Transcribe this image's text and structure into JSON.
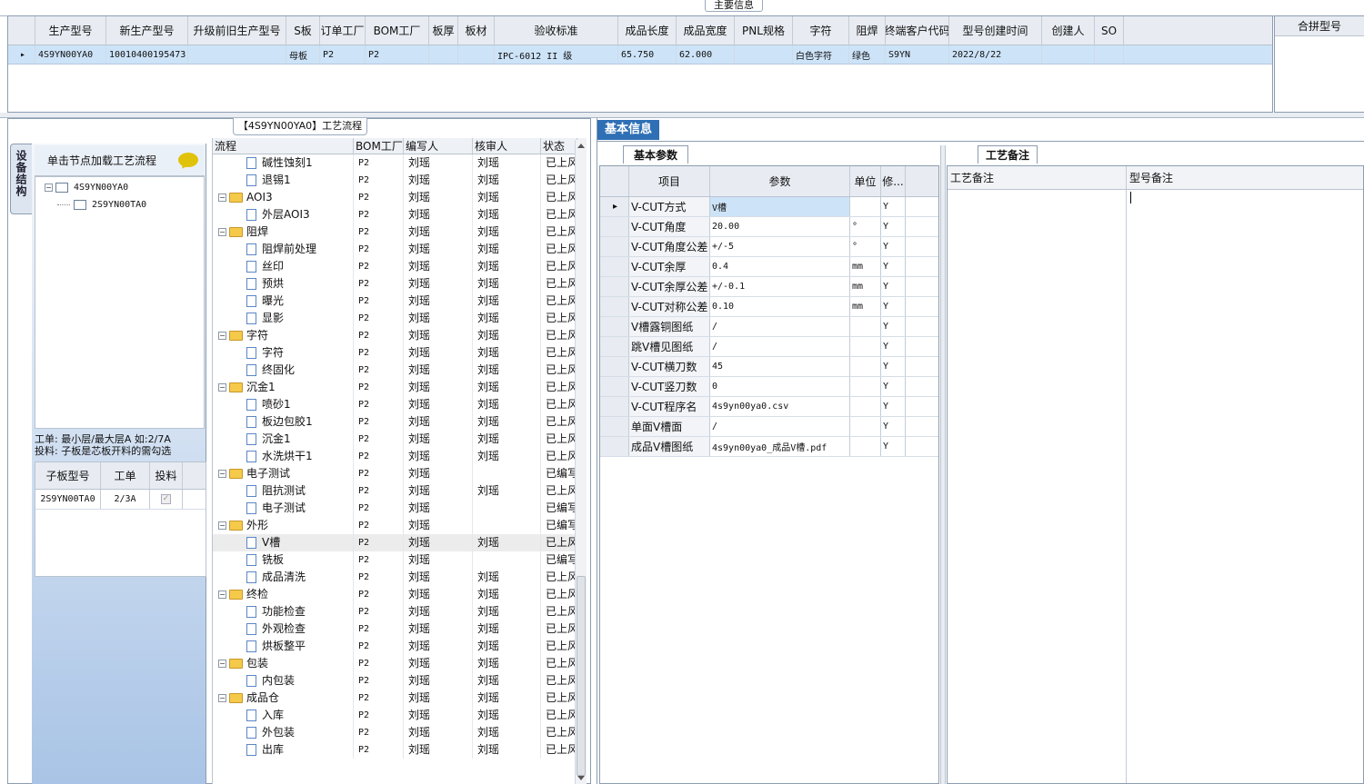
{
  "main": {
    "title": "主要信息",
    "columns": [
      "生产型号",
      "新生产型号",
      "升级前旧生产型号",
      "S板",
      "订单工厂",
      "BOM工厂",
      "板厚",
      "板材",
      "验收标准",
      "成品长度",
      "成品宽度",
      "PNL规格",
      "字符",
      "阻焊",
      "终端客户代码",
      "型号创建时间",
      "创建人",
      "SO"
    ],
    "row": [
      "4S9YN00YA0",
      "10010400195473",
      "",
      "母板",
      "P2",
      "P2",
      "",
      "",
      "IPC-6012 II 级",
      "65.750",
      "62.000",
      "",
      "白色字符",
      "绿色",
      "S9YN",
      "2022/8/22",
      "",
      ""
    ],
    "merge_title": "合拼型号"
  },
  "left": {
    "process_title": "【4S9YN00YA0】工艺流程",
    "side_tab": "设备结构",
    "click_hint": "单击节点加载工艺流程",
    "tree": [
      "4S9YN00YA0",
      "2S9YN00TA0"
    ],
    "note_line1": "工单: 最小层/最大层A 如:2/7A",
    "note_line2": "投料: 子板是芯板开料的需勾选",
    "sub_columns": [
      "子板型号",
      "工单",
      "投料"
    ],
    "sub_row": [
      "2S9YN00TA0",
      "2/3A",
      ""
    ]
  },
  "process": {
    "columns": [
      "流程",
      "BOM工厂",
      "编写人",
      "核审人",
      "状态"
    ],
    "rows": [
      {
        "name": "碱性蚀刻1",
        "level": 2,
        "type": "doc",
        "bom": "P2",
        "writer": "刘瑶",
        "reviewer": "刘瑶",
        "status": "已上风"
      },
      {
        "name": "退锡1",
        "level": 2,
        "type": "doc",
        "bom": "P2",
        "writer": "刘瑶",
        "reviewer": "刘瑶",
        "status": "已上风"
      },
      {
        "name": "AOI3",
        "level": 1,
        "type": "folder",
        "bom": "P2",
        "writer": "刘瑶",
        "reviewer": "刘瑶",
        "status": "已上风"
      },
      {
        "name": "外层AOI3",
        "level": 2,
        "type": "doc",
        "bom": "P2",
        "writer": "刘瑶",
        "reviewer": "刘瑶",
        "status": "已上风"
      },
      {
        "name": "阻焊",
        "level": 1,
        "type": "folder",
        "bom": "P2",
        "writer": "刘瑶",
        "reviewer": "刘瑶",
        "status": "已上风"
      },
      {
        "name": "阻焊前处理",
        "level": 2,
        "type": "doc",
        "bom": "P2",
        "writer": "刘瑶",
        "reviewer": "刘瑶",
        "status": "已上风"
      },
      {
        "name": "丝印",
        "level": 2,
        "type": "doc",
        "bom": "P2",
        "writer": "刘瑶",
        "reviewer": "刘瑶",
        "status": "已上风"
      },
      {
        "name": "预烘",
        "level": 2,
        "type": "doc",
        "bom": "P2",
        "writer": "刘瑶",
        "reviewer": "刘瑶",
        "status": "已上风"
      },
      {
        "name": "曝光",
        "level": 2,
        "type": "doc",
        "bom": "P2",
        "writer": "刘瑶",
        "reviewer": "刘瑶",
        "status": "已上风"
      },
      {
        "name": "显影",
        "level": 2,
        "type": "doc",
        "bom": "P2",
        "writer": "刘瑶",
        "reviewer": "刘瑶",
        "status": "已上风"
      },
      {
        "name": "字符",
        "level": 1,
        "type": "folder",
        "bom": "P2",
        "writer": "刘瑶",
        "reviewer": "刘瑶",
        "status": "已上风"
      },
      {
        "name": "字符",
        "level": 2,
        "type": "doc",
        "bom": "P2",
        "writer": "刘瑶",
        "reviewer": "刘瑶",
        "status": "已上风"
      },
      {
        "name": "终固化",
        "level": 2,
        "type": "doc",
        "bom": "P2",
        "writer": "刘瑶",
        "reviewer": "刘瑶",
        "status": "已上风"
      },
      {
        "name": "沉金1",
        "level": 1,
        "type": "folder",
        "bom": "P2",
        "writer": "刘瑶",
        "reviewer": "刘瑶",
        "status": "已上风"
      },
      {
        "name": "喷砂1",
        "level": 2,
        "type": "doc",
        "bom": "P2",
        "writer": "刘瑶",
        "reviewer": "刘瑶",
        "status": "已上风"
      },
      {
        "name": "板边包胶1",
        "level": 2,
        "type": "doc",
        "bom": "P2",
        "writer": "刘瑶",
        "reviewer": "刘瑶",
        "status": "已上风"
      },
      {
        "name": "沉金1",
        "level": 2,
        "type": "doc",
        "bom": "P2",
        "writer": "刘瑶",
        "reviewer": "刘瑶",
        "status": "已上风"
      },
      {
        "name": "水洗烘干1",
        "level": 2,
        "type": "doc",
        "bom": "P2",
        "writer": "刘瑶",
        "reviewer": "刘瑶",
        "status": "已上风"
      },
      {
        "name": "电子测试",
        "level": 1,
        "type": "folder",
        "bom": "P2",
        "writer": "刘瑶",
        "reviewer": "",
        "status": "已编写"
      },
      {
        "name": "阻抗测试",
        "level": 2,
        "type": "doc",
        "bom": "P2",
        "writer": "刘瑶",
        "reviewer": "刘瑶",
        "status": "已上风"
      },
      {
        "name": "电子测试",
        "level": 2,
        "type": "doc",
        "bom": "P2",
        "writer": "刘瑶",
        "reviewer": "",
        "status": "已编写"
      },
      {
        "name": "外形",
        "level": 1,
        "type": "folder",
        "bom": "P2",
        "writer": "刘瑶",
        "reviewer": "",
        "status": "已编写"
      },
      {
        "name": "V槽",
        "level": 2,
        "type": "doc",
        "bom": "P2",
        "writer": "刘瑶",
        "reviewer": "刘瑶",
        "status": "已上风",
        "selected": true
      },
      {
        "name": "铣板",
        "level": 2,
        "type": "doc",
        "bom": "P2",
        "writer": "刘瑶",
        "reviewer": "",
        "status": "已编写"
      },
      {
        "name": "成品清洗",
        "level": 2,
        "type": "doc",
        "bom": "P2",
        "writer": "刘瑶",
        "reviewer": "刘瑶",
        "status": "已上风"
      },
      {
        "name": "终检",
        "level": 1,
        "type": "folder",
        "bom": "P2",
        "writer": "刘瑶",
        "reviewer": "刘瑶",
        "status": "已上风"
      },
      {
        "name": "功能检查",
        "level": 2,
        "type": "doc",
        "bom": "P2",
        "writer": "刘瑶",
        "reviewer": "刘瑶",
        "status": "已上风"
      },
      {
        "name": "外观检查",
        "level": 2,
        "type": "doc",
        "bom": "P2",
        "writer": "刘瑶",
        "reviewer": "刘瑶",
        "status": "已上风"
      },
      {
        "name": "烘板整平",
        "level": 2,
        "type": "doc",
        "bom": "P2",
        "writer": "刘瑶",
        "reviewer": "刘瑶",
        "status": "已上风"
      },
      {
        "name": "包装",
        "level": 1,
        "type": "folder",
        "bom": "P2",
        "writer": "刘瑶",
        "reviewer": "刘瑶",
        "status": "已上风"
      },
      {
        "name": "内包装",
        "level": 2,
        "type": "doc",
        "bom": "P2",
        "writer": "刘瑶",
        "reviewer": "刘瑶",
        "status": "已上风"
      },
      {
        "name": "成品仓",
        "level": 1,
        "type": "folder",
        "bom": "P2",
        "writer": "刘瑶",
        "reviewer": "刘瑶",
        "status": "已上风"
      },
      {
        "name": "入库",
        "level": 2,
        "type": "doc",
        "bom": "P2",
        "writer": "刘瑶",
        "reviewer": "刘瑶",
        "status": "已上风"
      },
      {
        "name": "外包装",
        "level": 2,
        "type": "doc",
        "bom": "P2",
        "writer": "刘瑶",
        "reviewer": "刘瑶",
        "status": "已上风"
      },
      {
        "name": "出库",
        "level": 2,
        "type": "doc",
        "bom": "P2",
        "writer": "刘瑶",
        "reviewer": "刘瑶",
        "status": "已上风"
      }
    ]
  },
  "right": {
    "basic_tab": "基本信息",
    "param_tab": "基本参数",
    "param_columns": [
      "项目",
      "参数",
      "单位",
      "修..."
    ],
    "params": [
      [
        "V-CUT方式",
        "V槽",
        "",
        "Y"
      ],
      [
        "V-CUT角度",
        "20.00",
        "°",
        "Y"
      ],
      [
        "V-CUT角度公差",
        "+/-5",
        "°",
        "Y"
      ],
      [
        "V-CUT余厚",
        "0.4",
        "mm",
        "Y"
      ],
      [
        "V-CUT余厚公差",
        "+/-0.1",
        "mm",
        "Y"
      ],
      [
        "V-CUT对称公差",
        "0.10",
        "mm",
        "Y"
      ],
      [
        "V槽露铜图纸",
        "/",
        "",
        "Y"
      ],
      [
        "跳V槽见图纸",
        "/",
        "",
        "Y"
      ],
      [
        "V-CUT横刀数",
        "45",
        "",
        "Y"
      ],
      [
        "V-CUT竖刀数",
        "0",
        "",
        "Y"
      ],
      [
        "V-CUT程序名",
        "4s9yn00ya0.csv",
        "",
        "Y"
      ],
      [
        "单面V槽面",
        "/",
        "",
        "Y"
      ],
      [
        "成品V槽图纸",
        "4s9yn00ya0_成品V槽.pdf",
        "",
        "Y"
      ]
    ],
    "remark_tab": "工艺备注",
    "remark_col1": "工艺备注",
    "remark_col2": "型号备注"
  },
  "colors": {
    "selection": "#cde3f8",
    "tab_blue": "#2f6fb5",
    "folder": "#f5c94a"
  }
}
